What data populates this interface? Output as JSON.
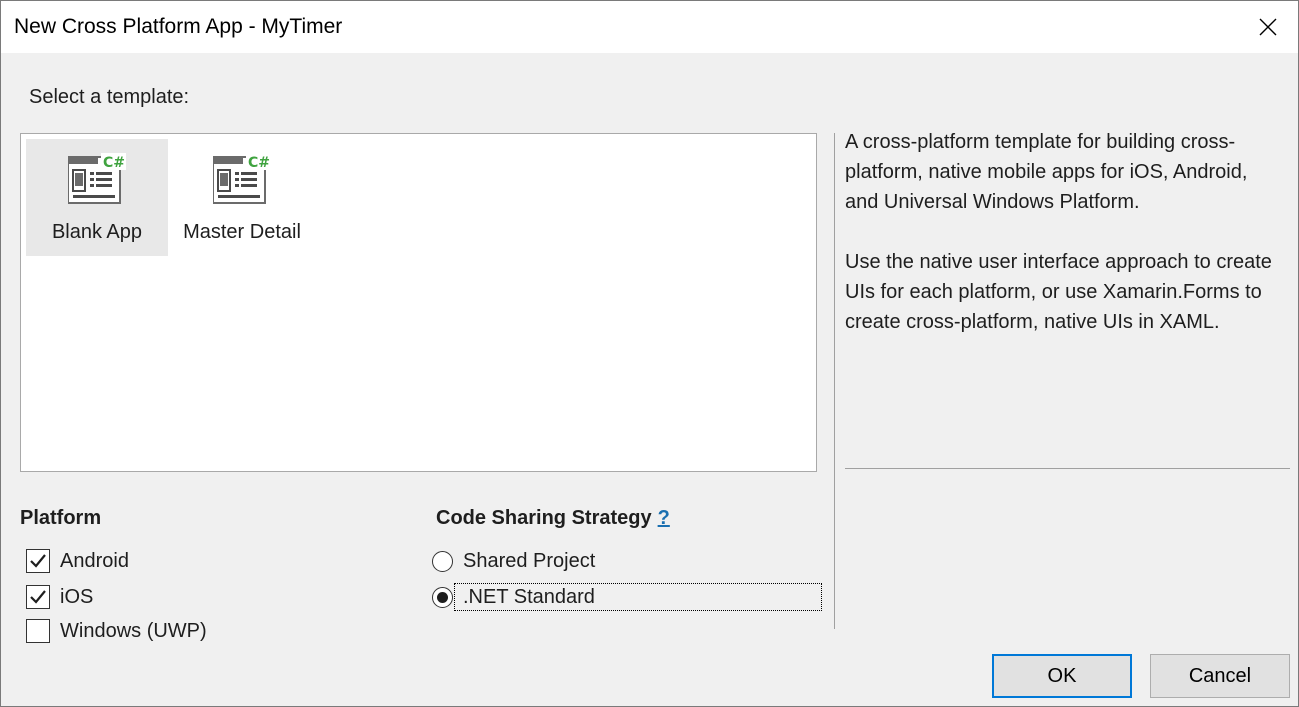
{
  "window": {
    "title": "New Cross Platform App - MyTimer"
  },
  "icons": {
    "close": "close-icon",
    "template": "csharp-template-icon",
    "check": "checkmark-icon"
  },
  "templates": {
    "label": "Select a template:",
    "items": [
      {
        "name": "Blank App",
        "selected": true
      },
      {
        "name": "Master Detail",
        "selected": false
      }
    ]
  },
  "description": {
    "para1": "A cross-platform template for building cross-platform, native mobile apps for iOS, Android, and Universal Windows Platform.",
    "para2": "Use the native user interface approach to create UIs for each platform, or use Xamarin.Forms to create cross-platform, native UIs in XAML."
  },
  "platform": {
    "title": "Platform",
    "options": [
      {
        "label": "Android",
        "checked": true
      },
      {
        "label": "iOS",
        "checked": true
      },
      {
        "label": "Windows (UWP)",
        "checked": false
      }
    ]
  },
  "code_sharing": {
    "title": "Code Sharing Strategy",
    "help": "?",
    "options": [
      {
        "label": "Shared Project",
        "selected": false
      },
      {
        "label": ".NET Standard",
        "selected": true
      }
    ]
  },
  "buttons": {
    "ok": "OK",
    "cancel": "Cancel"
  },
  "colors": {
    "accent": "#0078d7",
    "link": "#1a6fb0",
    "csharp_green": "#3fa33f"
  }
}
